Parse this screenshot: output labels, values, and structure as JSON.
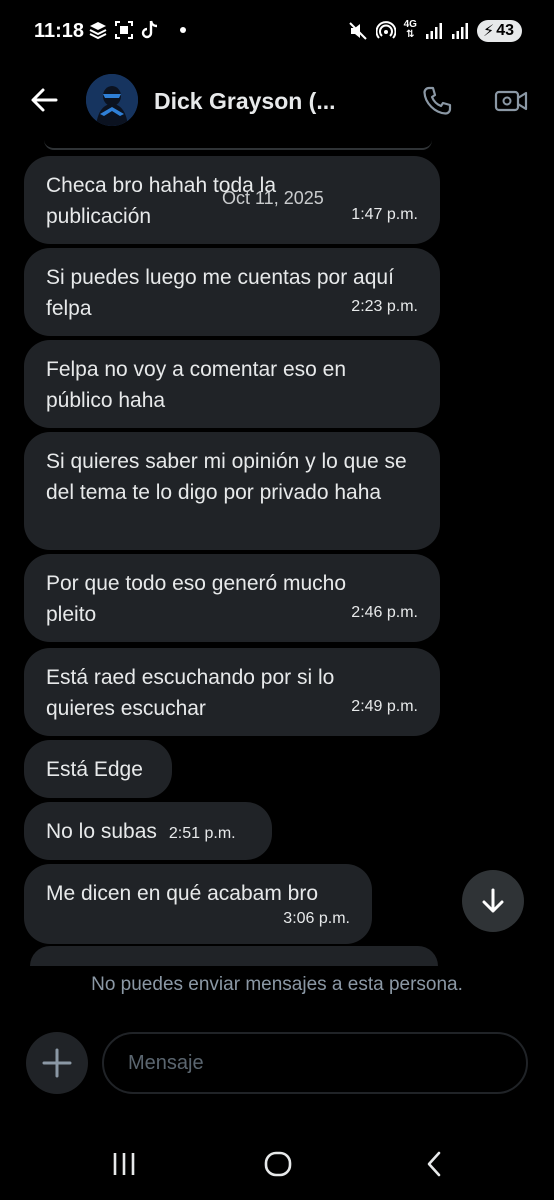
{
  "status_bar": {
    "time": "11:18",
    "network": "4G",
    "battery": "43",
    "left_icons": [
      "layers-icon",
      "scan-icon",
      "tiktok-icon"
    ],
    "right_icons": [
      "mute-icon",
      "hotspot-icon",
      "data-arrows-icon",
      "signal-icon",
      "signal-icon",
      "battery-icon"
    ]
  },
  "header": {
    "contact_name": "Dick Grayson (...",
    "back_icon": "arrow-left-icon",
    "call_icon": "phone-icon",
    "video_icon": "video-camera-icon"
  },
  "date_overlay": "Oct 11, 2025",
  "messages": [
    {
      "text": "Checa bro hahah toda la publicación",
      "time": "1:47 p.m."
    },
    {
      "text": "Si puedes luego me cuentas por aquí felpa",
      "time": "2:23 p.m."
    },
    {
      "text": "Felpa no voy a comentar eso en público haha",
      "time": ""
    },
    {
      "text": "Si quieres saber mi opinión y lo que se del tema te lo digo por privado haha",
      "time": ""
    },
    {
      "text": "Por que todo eso generó mucho pleito",
      "time": "2:46 p.m."
    },
    {
      "text": "Está raed escuchando por si lo quieres escuchar",
      "time": "2:49 p.m."
    },
    {
      "text": "Está Edge",
      "time": ""
    },
    {
      "text": "No lo subas",
      "time": "2:51 p.m."
    },
    {
      "text": "Me dicen en qué acabam bro",
      "time": "3:06 p.m."
    }
  ],
  "footer": {
    "notice": "No puedes enviar mensajes a esta persona.",
    "input_placeholder": "Mensaje"
  },
  "colors": {
    "background": "#000000",
    "bubble": "#202327",
    "text": "#e7e9ea",
    "muted": "#8b98a5"
  }
}
